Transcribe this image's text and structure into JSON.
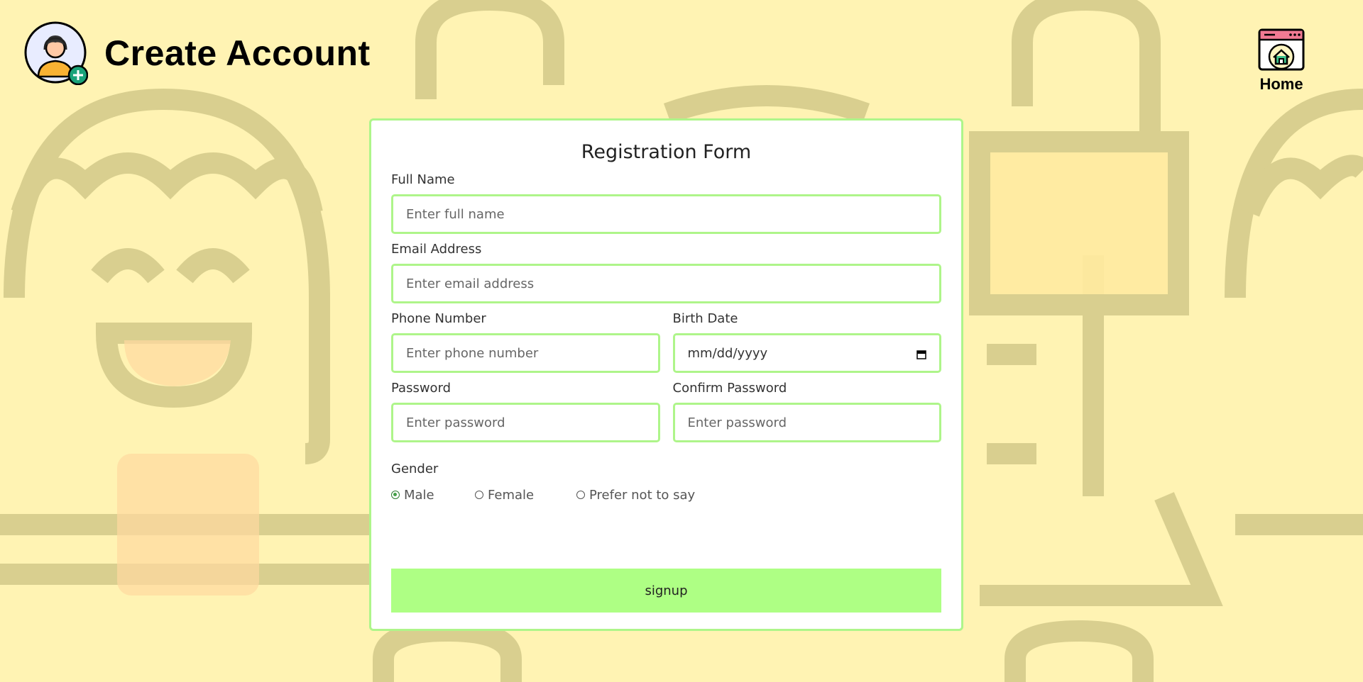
{
  "header": {
    "title": "Create Account"
  },
  "nav": {
    "home_label": "Home"
  },
  "form": {
    "title": "Registration Form",
    "full_name": {
      "label": "Full Name",
      "placeholder": "Enter full name"
    },
    "email": {
      "label": "Email Address",
      "placeholder": "Enter email address"
    },
    "phone": {
      "label": "Phone Number",
      "placeholder": "Enter phone number"
    },
    "birth_date": {
      "label": "Birth Date",
      "value": "mm/dd/yyyy"
    },
    "password": {
      "label": "Password",
      "placeholder": "Enter password"
    },
    "confirm_password": {
      "label": "Confirm Password",
      "placeholder": "Enter password"
    },
    "gender": {
      "label": "Gender",
      "options": [
        "Male",
        "Female",
        "Prefer not to say"
      ],
      "selected": "Male"
    },
    "submit_label": "signup"
  },
  "colors": {
    "background": "#fff3b3",
    "accent_border": "#aef58a",
    "button": "#aeff84"
  },
  "icons": {
    "avatar": "user-add-icon",
    "home": "home-browser-icon",
    "calendar": "calendar-icon"
  }
}
